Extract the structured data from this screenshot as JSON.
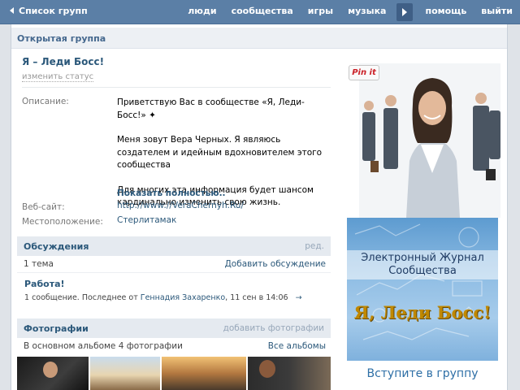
{
  "topbar": {
    "back_label": "Список групп",
    "nav": [
      "люди",
      "сообщества",
      "игры",
      "музыка",
      "помощь",
      "выйти"
    ]
  },
  "group": {
    "type_label": "Открытая группа",
    "title": "Я – Леди Босс!",
    "change_status": "изменить статус"
  },
  "info": {
    "description_label": "Описание:",
    "description": [
      "Приветствую Вас в сообществе «Я, Леди-Босс!» ✦",
      "Меня зовут Вера Черных. Я являюсь создателем и идейным вдохновителем этого сообщества",
      "Для многих эта информация будет шансом кардинально изменить свою жизнь."
    ],
    "show_more": "Показать полностью..",
    "website_label": "Веб-сайт:",
    "website": "http://www://VeraChernyh.Ru/",
    "location_label": "Местоположение:",
    "location": "Стерлитамак"
  },
  "discussions": {
    "title": "Обсуждения",
    "edit": "ред.",
    "count": "1 тема",
    "add": "Добавить обсуждение",
    "topic_title": "Работа!",
    "topic_meta_prefix": "1 сообщение. Последнее от",
    "topic_author": "Геннадия Захаренко",
    "topic_time": ", 11 сен в 14:06",
    "topic_arrow": "→"
  },
  "photos": {
    "title": "Фотографии",
    "add": "добавить фотографии",
    "main_album": "В основном альбоме 4 фотографии",
    "all_albums": "Все альбомы"
  },
  "sidebar": {
    "pin_label": "Pin it",
    "banner_line1": "Электронный Журнал",
    "banner_line2": "Сообщества",
    "banner_slogan": "Я, Леди Босс!",
    "banner_cta": "Вступите в группу"
  },
  "icons": [
    "back-arrow-icon",
    "more-arrow-icon",
    "pinterest-icon",
    "right-arrow-icon"
  ],
  "colors": {
    "topbar": "#5b7fa6",
    "link": "#2b587a",
    "block_header": "#e5eaf0",
    "page_bg": "#dfe3e8"
  }
}
